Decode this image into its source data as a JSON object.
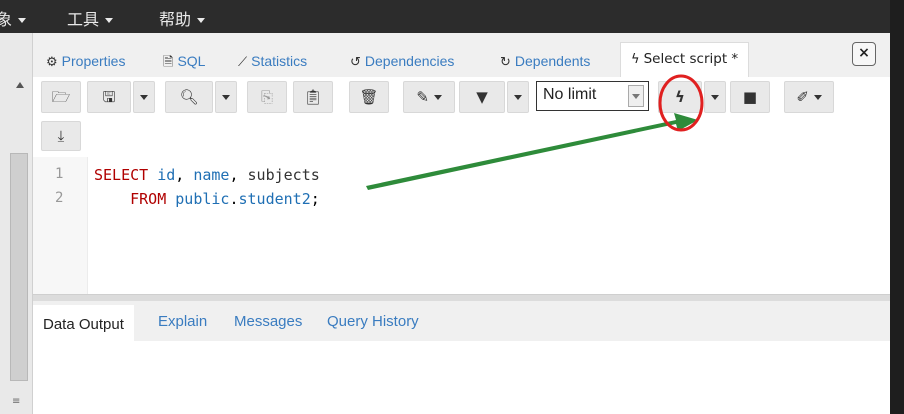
{
  "menubar": {
    "items": [
      {
        "label": "象"
      },
      {
        "label": "工具"
      },
      {
        "label": "帮助"
      }
    ]
  },
  "tabs": [
    {
      "label": "Properties",
      "icon": "properties-icon"
    },
    {
      "label": "SQL",
      "icon": "sql-icon"
    },
    {
      "label": "Statistics",
      "icon": "statistics-icon"
    },
    {
      "label": "Dependencies",
      "icon": "dependencies-icon"
    },
    {
      "label": "Dependents",
      "icon": "dependents-icon"
    },
    {
      "label": "Select script *",
      "icon": "bolt-icon"
    }
  ],
  "toolbar": {
    "limit_value": "No limit"
  },
  "editor": {
    "line_numbers": [
      "1",
      "2"
    ]
  },
  "output_tabs": [
    {
      "label": "Data Output"
    },
    {
      "label": "Explain"
    },
    {
      "label": "Messages"
    },
    {
      "label": "Query History"
    }
  ],
  "colors": {
    "annotation_arrow": "#2e8b3a",
    "annotation_circle": "#e02020",
    "link": "#3a7cc0"
  }
}
